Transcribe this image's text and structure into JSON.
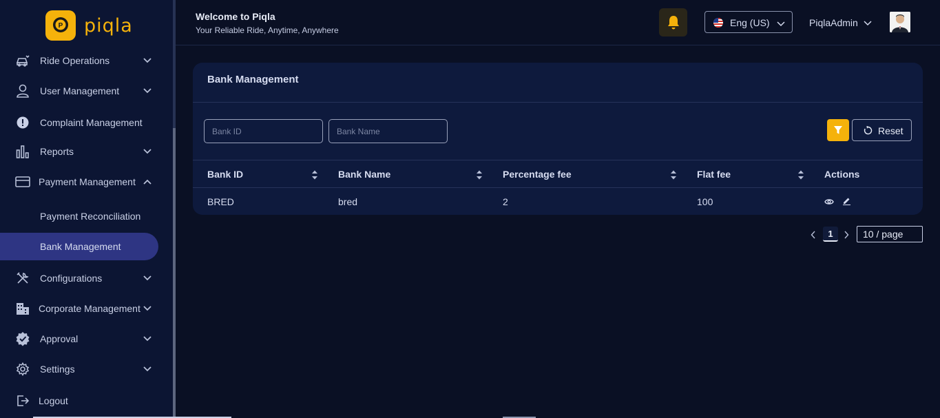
{
  "brand": {
    "name": "piqla",
    "accent": "#f5b20b"
  },
  "header": {
    "title": "Welcome to Piqla",
    "subtitle": "Your Reliable Ride, Anytime, Anywhere",
    "language": "Eng (US)",
    "user": "PiqlaAdmin"
  },
  "sidebar": {
    "items": [
      {
        "label": "Ride Operations",
        "icon": "car-icon",
        "expandable": true
      },
      {
        "label": "User Management",
        "icon": "user-icon",
        "expandable": true
      },
      {
        "label": "Complaint Management",
        "icon": "alert-circle-icon",
        "expandable": false
      },
      {
        "label": "Reports",
        "icon": "bar-chart-icon",
        "expandable": true
      },
      {
        "label": "Payment Management",
        "icon": "credit-card-icon",
        "expandable": true,
        "expanded": true
      },
      {
        "label": "Payment Reconciliation",
        "sub": true
      },
      {
        "label": "Bank Management",
        "sub": true,
        "active": true
      },
      {
        "label": "Configurations",
        "icon": "tools-icon",
        "expandable": true
      },
      {
        "label": "Corporate Management",
        "icon": "building-icon",
        "expandable": true
      },
      {
        "label": "Approval",
        "icon": "badge-check-icon",
        "expandable": true
      },
      {
        "label": "Settings",
        "icon": "gear-icon",
        "expandable": true
      },
      {
        "label": "Logout",
        "icon": "logout-icon",
        "expandable": false
      }
    ]
  },
  "card": {
    "title": "Bank Management",
    "filters": {
      "bank_id_placeholder": "Bank ID",
      "bank_name_placeholder": "Bank Name"
    },
    "reset_label": "Reset",
    "table": {
      "columns": [
        "Bank ID",
        "Bank Name",
        "Percentage fee",
        "Flat fee",
        "Actions"
      ],
      "rows": [
        {
          "bank_id": "BRED",
          "bank_name": "bred",
          "percentage_fee": "2",
          "flat_fee": "100"
        }
      ]
    }
  },
  "pagination": {
    "current_page": "1",
    "page_size": "10 / page"
  }
}
